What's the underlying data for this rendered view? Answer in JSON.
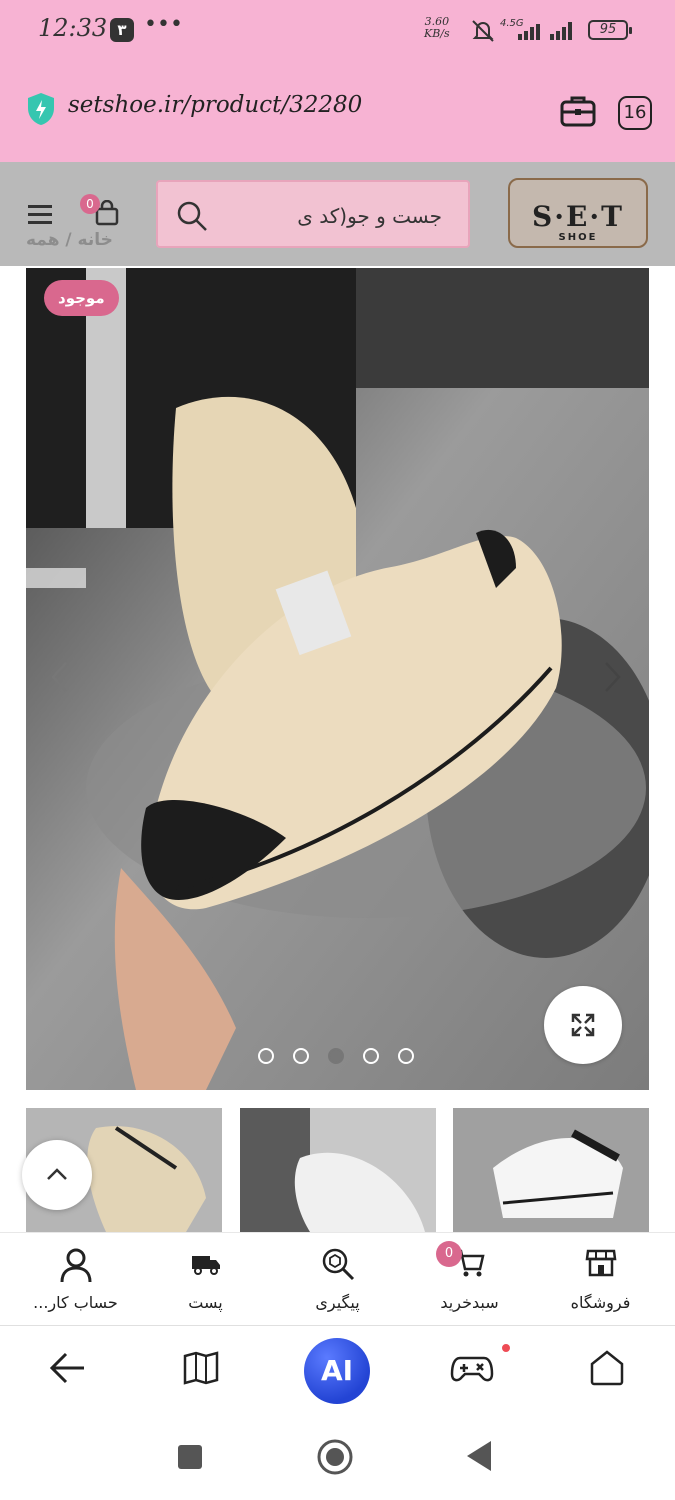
{
  "status_bar": {
    "time": "12:33",
    "notification_badge": "۳",
    "more": "•••",
    "speed_value": "3.60",
    "speed_unit": "KB/s",
    "network": "4.5G",
    "battery": "95"
  },
  "browser": {
    "url": "setshoe.ir/product/32280",
    "tab_count": "16"
  },
  "header": {
    "cart_count": "0",
    "search_placeholder": "جست و جو(کد ی",
    "logo_main": "S·E·T",
    "logo_sub": "SHOE",
    "breadcrumb": "خانه  /  همه"
  },
  "product": {
    "stock_badge": "موجود",
    "dots_total": 5,
    "dots_active_index": 2
  },
  "site_nav": {
    "items": [
      {
        "label": "فروشگاه",
        "icon": "store-icon"
      },
      {
        "label": "سبدخرید",
        "icon": "cart-icon"
      },
      {
        "label": "پیگیری",
        "icon": "tracking-icon"
      },
      {
        "label": "پست",
        "icon": "truck-icon"
      },
      {
        "label": "حساب کار...",
        "icon": "user-icon"
      }
    ],
    "cart_badge": "0"
  },
  "browser_toolbar": {
    "ai_label": "AI"
  },
  "colors": {
    "chrome_pink": "#f7b3d3",
    "accent_pink": "#d9688e",
    "ai_blue": "#2344d4"
  }
}
